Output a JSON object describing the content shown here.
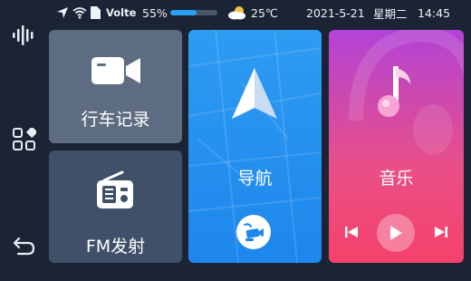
{
  "status": {
    "network_label": "Volte",
    "battery_percent_text": "55%",
    "battery_level": 0.55,
    "temperature": "25℃",
    "date": "2021-5-21",
    "weekday": "星期二",
    "time": "14:45"
  },
  "sidebar": {
    "icons": [
      "voice-icon",
      "apps-grid-icon",
      "back-icon"
    ]
  },
  "tiles": {
    "recorder": {
      "label": "行车记录",
      "icon": "camera-icon"
    },
    "fm": {
      "label": "FM发射",
      "icon": "radio-icon"
    },
    "navigation": {
      "label": "导航",
      "icon": "navigation-arrow-icon",
      "sub_icon": "camera-signal-icon"
    },
    "music": {
      "label": "音乐",
      "icon": "music-note-icon"
    }
  },
  "music_controls": [
    "previous-track-icon",
    "play-icon",
    "next-track-icon"
  ],
  "colors": {
    "background": "#1b2434",
    "recorder_tile": "#5d6c80",
    "fm_tile": "#3f5068",
    "navigation_tile": "#2596f0",
    "music_tile_top": "#b243d6",
    "music_tile_bottom": "#f5426a",
    "battery_fill": "#2a9df4"
  }
}
